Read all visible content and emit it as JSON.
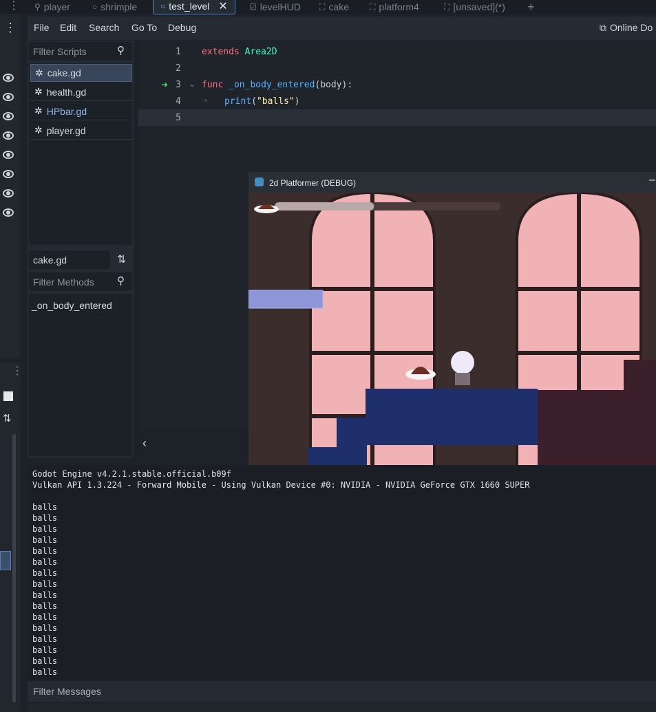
{
  "tabs": [
    {
      "label": "player",
      "icon": "node-icon",
      "active": false
    },
    {
      "label": "shrimple",
      "icon": "circle-icon",
      "active": false
    },
    {
      "label": "test_level",
      "icon": "circle-icon",
      "active": true
    },
    {
      "label": "levelHUD",
      "icon": "control-icon",
      "active": false
    },
    {
      "label": "cake",
      "icon": "area-icon",
      "active": false
    },
    {
      "label": "platform4",
      "icon": "static-icon",
      "active": false
    },
    {
      "label": "[unsaved](*)",
      "icon": "area-icon",
      "active": false
    }
  ],
  "menu": {
    "items": [
      "File",
      "Edit",
      "Search",
      "Go To",
      "Debug"
    ],
    "online_docs": "Online Do"
  },
  "scripts": {
    "filter_placeholder": "Filter Scripts",
    "items": [
      {
        "label": "cake.gd",
        "selected": true
      },
      {
        "label": "health.gd",
        "selected": false
      },
      {
        "label": "HPbar.gd",
        "selected": false,
        "color": "#8fb6e8"
      },
      {
        "label": "player.gd",
        "selected": false
      }
    ],
    "current_file": "cake.gd",
    "methods_placeholder": "Filter Methods",
    "methods": [
      "_on_body_entered"
    ]
  },
  "editor": {
    "line_numbers": [
      "1",
      "2",
      "3",
      "4",
      "5"
    ],
    "line1_kw": "extends",
    "line1_type": "Area2D",
    "line3_kw": "func",
    "line3_fn": "_on_body_entered",
    "line3_rest": "(body):",
    "line4_fn": "print",
    "line4_open": "(",
    "line4_str": "\"balls\"",
    "line4_close": ")"
  },
  "game": {
    "window_title": "2d Platformer (DEBUG)",
    "health_fraction": 0.44
  },
  "output": {
    "lines": [
      "Godot Engine v4.2.1.stable.official.b09f",
      "Vulkan API 1.3.224 - Forward Mobile - Using Vulkan Device #0: NVIDIA - NVIDIA GeForce GTX 1660 SUPER",
      "",
      "balls",
      "balls",
      "balls",
      "balls",
      "balls",
      "balls",
      "balls",
      "balls",
      "balls",
      "balls",
      "balls",
      "balls",
      "balls",
      "balls",
      "balls",
      "balls"
    ],
    "filter_placeholder": "Filter Messages"
  },
  "colors": {
    "accent": "#4f88d6",
    "background": "#1d2229"
  }
}
